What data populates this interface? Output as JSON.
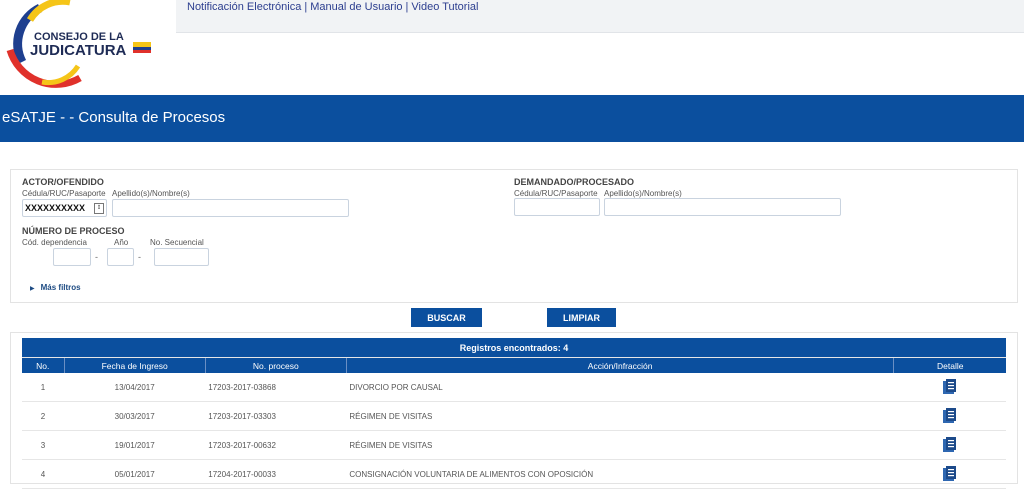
{
  "brand": {
    "logo_line1": "CONSEJO DE LA",
    "logo_line2": "JUDICATURA"
  },
  "top_links": [
    "Notificación Electrónica",
    "Manual de Usuario",
    "Video Tutorial"
  ],
  "page_title": "eSATJE - - Consulta de Procesos",
  "filters": {
    "actor": {
      "section": "ACTOR/OFENDIDO",
      "id_label": "Cédula/RUC/Pasaporte",
      "id_value": "XXXXXXXXXX",
      "name_label": "Apellido(s)/Nombre(s)",
      "name_value": ""
    },
    "demandado": {
      "section": "DEMANDADO/PROCESADO",
      "id_label": "Cédula/RUC/Pasaporte",
      "id_value": "",
      "name_label": "Apellido(s)/Nombre(s)",
      "name_value": ""
    },
    "proceso": {
      "section": "NÚMERO DE PROCESO",
      "dep_label": "Cód. dependencia",
      "year_label": "Año",
      "seq_label": "No. Secuencial",
      "dash": "-"
    },
    "more_filters": "Más filtros"
  },
  "buttons": {
    "search": "BUSCAR",
    "clear": "LIMPIAR"
  },
  "results": {
    "caption": "Registros encontrados: 4",
    "columns": [
      "No.",
      "Fecha de Ingreso",
      "No. proceso",
      "Acción/Infracción",
      "Detalle"
    ],
    "rows": [
      {
        "no": "1",
        "fecha": "13/04/2017",
        "proceso": "17203-2017-03868",
        "accion": "DIVORCIO POR CAUSAL"
      },
      {
        "no": "2",
        "fecha": "30/03/2017",
        "proceso": "17203-2017-03303",
        "accion": "RÉGIMEN DE VISITAS"
      },
      {
        "no": "3",
        "fecha": "19/01/2017",
        "proceso": "17203-2017-00632",
        "accion": "RÉGIMEN DE VISITAS"
      },
      {
        "no": "4",
        "fecha": "05/01/2017",
        "proceso": "17204-2017-00033",
        "accion": "CONSIGNACIÓN VOLUNTARIA DE ALIMENTOS CON OPOSICIÓN"
      }
    ],
    "detail_icon": "document-icon"
  },
  "colors": {
    "primary": "#0b4f9e",
    "link": "#2c3e8f"
  }
}
